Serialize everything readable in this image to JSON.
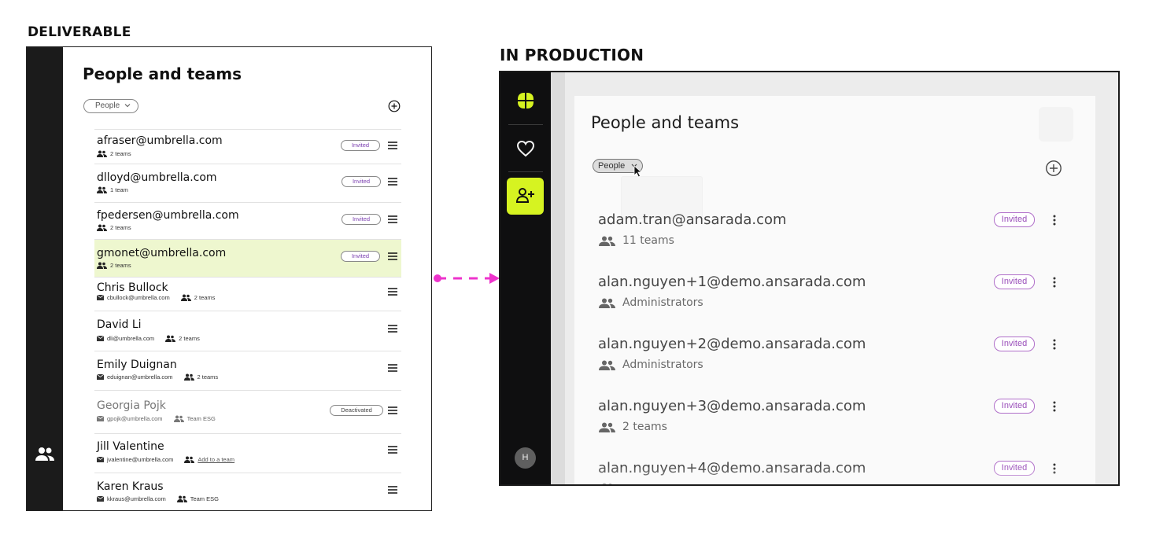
{
  "captions": {
    "deliverable": "DELIVERABLE",
    "production": "IN PRODUCTION"
  },
  "colors": {
    "accent_lime": "#d6f321",
    "highlight_row": "#eef7cf",
    "invited_purple": "#9a4fba",
    "connector_pink": "#ee33cc",
    "rail_dark": "#1b1b1b"
  },
  "deliverable": {
    "title": "People and teams",
    "filter_value": "People",
    "rail_icon": "people-icon",
    "add_icon": "add-circle-icon",
    "rows": [
      {
        "name": "afraser@umbrella.com",
        "teams": "2 teams",
        "status": "Invited"
      },
      {
        "name": "dlloyd@umbrella.com",
        "teams": "1 team",
        "status": "Invited"
      },
      {
        "name": "fpedersen@umbrella.com",
        "teams": "2 teams",
        "status": "Invited"
      },
      {
        "name": "gmonet@umbrella.com",
        "teams": "2 teams",
        "status": "Invited",
        "highlighted": true
      },
      {
        "name": "Chris Bullock",
        "email": "cbullock@umbrella.com",
        "teams": "2 teams"
      },
      {
        "name": "David Li",
        "email": "dli@umbrella.com",
        "teams": "2 teams"
      },
      {
        "name": "Emily Duignan",
        "email": "eduignan@umbrella.com",
        "teams": "2 teams"
      },
      {
        "name": "Georgia Pojk",
        "email": "gpojk@umbrella.com",
        "teams": "Team ESG",
        "status": "Deactivated"
      },
      {
        "name": "Jill Valentine",
        "email": "jvalentine@umbrella.com",
        "teams": "Add to a team"
      },
      {
        "name": "Karen Kraus",
        "email": "kkraus@umbrella.com",
        "teams": "Team ESG"
      }
    ]
  },
  "production": {
    "title": "People and teams",
    "filter_value": "People",
    "avatar_initial": "H",
    "rail_icons": [
      "app-logo-icon",
      "heart-icon",
      "people-add-icon"
    ],
    "rows": [
      {
        "email": "adam.tran@ansarada.com",
        "sub": "11 teams",
        "status": "Invited"
      },
      {
        "email": "alan.nguyen+1@demo.ansarada.com",
        "sub": "Administrators",
        "status": "Invited"
      },
      {
        "email": "alan.nguyen+2@demo.ansarada.com",
        "sub": "Administrators",
        "status": "Invited"
      },
      {
        "email": "alan.nguyen+3@demo.ansarada.com",
        "sub": "2 teams",
        "status": "Invited"
      },
      {
        "email": "alan.nguyen+4@demo.ansarada.com",
        "sub": "",
        "status": "Invited"
      }
    ]
  }
}
